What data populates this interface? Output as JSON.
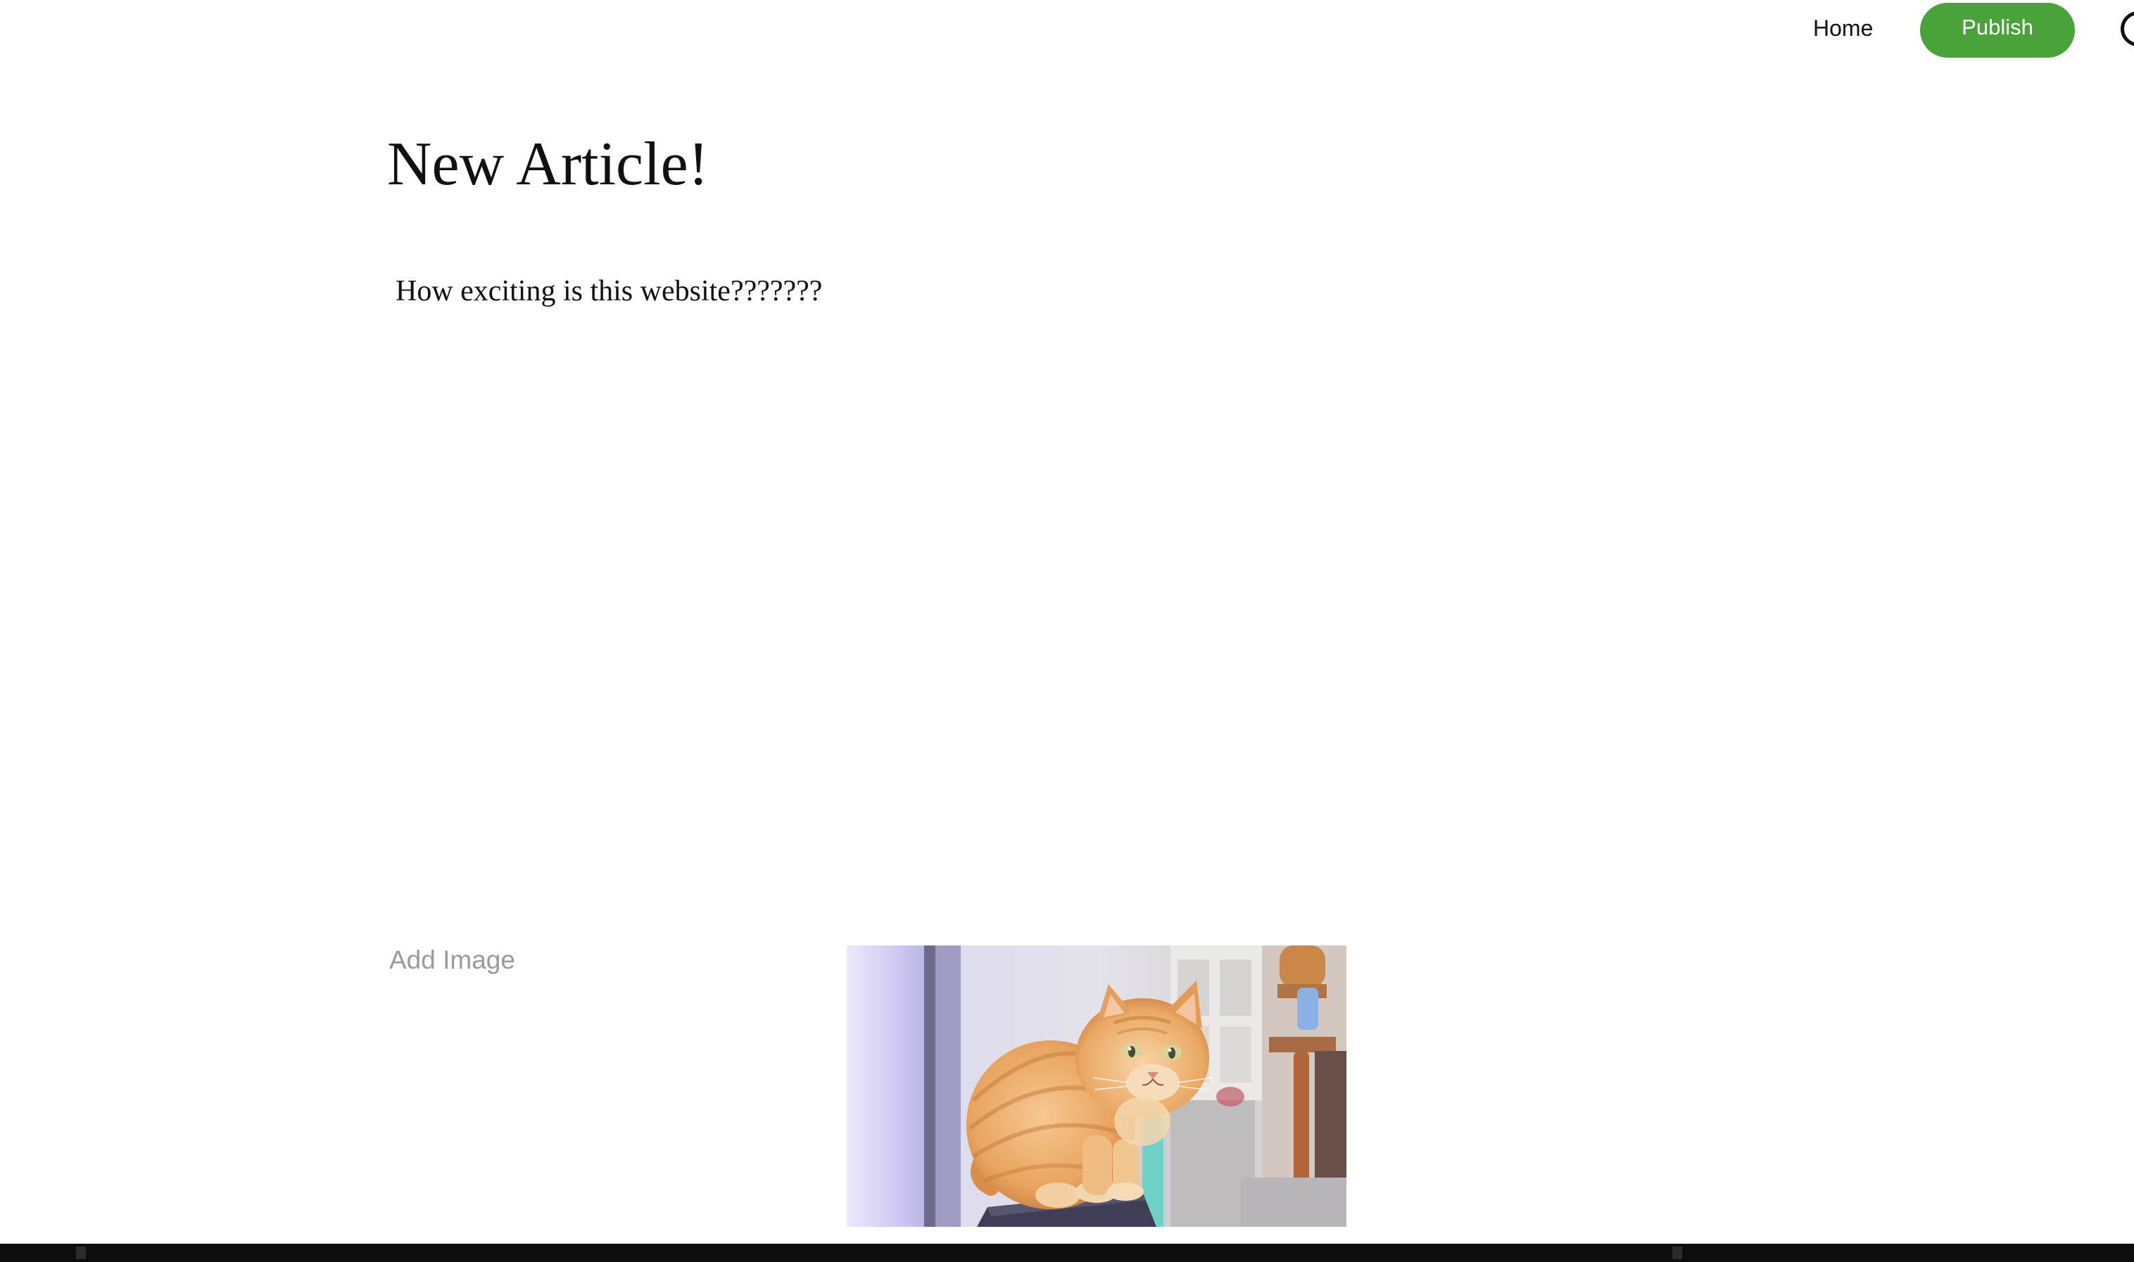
{
  "nav": {
    "home_label": "Home",
    "publish_label": "Publish",
    "publish_color": "#4aa23a",
    "avatar_icon": "user-avatar-icon"
  },
  "article": {
    "title": "New Article!",
    "body": "How exciting is this website???????"
  },
  "image_section": {
    "add_image_label": "Add Image",
    "image_subject": "orange tabby cat"
  }
}
